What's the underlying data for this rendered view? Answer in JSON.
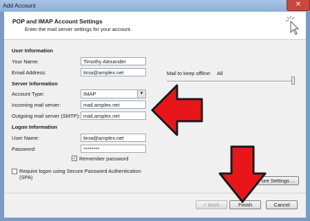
{
  "window": {
    "title": "Add Account",
    "close_glyph": "✕"
  },
  "header": {
    "title": "POP and IMAP Account Settings",
    "subtitle": "Enter the mail server settings for your account."
  },
  "user_info": {
    "heading": "User Information",
    "name_label": "Your Name:",
    "name_value": "Timothy Alexander",
    "email_label": "Email Address:",
    "email_value": "tima@amplex.net"
  },
  "server_info": {
    "heading": "Server Information",
    "type_label": "Account Type:",
    "type_value": "IMAP",
    "incoming_label": "Incoming mail server:",
    "incoming_value": "mail.amplex.net",
    "outgoing_label": "Outgoing mail server (SMTP):",
    "outgoing_value": "mail.amplex.net"
  },
  "logon_info": {
    "heading": "Logon Information",
    "username_label": "User Name:",
    "username_value": "tima@amplex.net",
    "password_label": "Password:",
    "password_value": "********",
    "remember_label": "Remember password",
    "remember_checked": true,
    "spa_label": "Require logon using Secure Password Authentication (SPA)",
    "spa_checked": false
  },
  "offline": {
    "label": "Mail to keep offline:",
    "value": "All"
  },
  "buttons": {
    "more_settings": "ore Settings ...",
    "back": "< Back",
    "finish": "Finish",
    "cancel": "Cancel"
  },
  "colors": {
    "arrow": "#e8161b",
    "arrow_outline": "#1a1a1a"
  }
}
